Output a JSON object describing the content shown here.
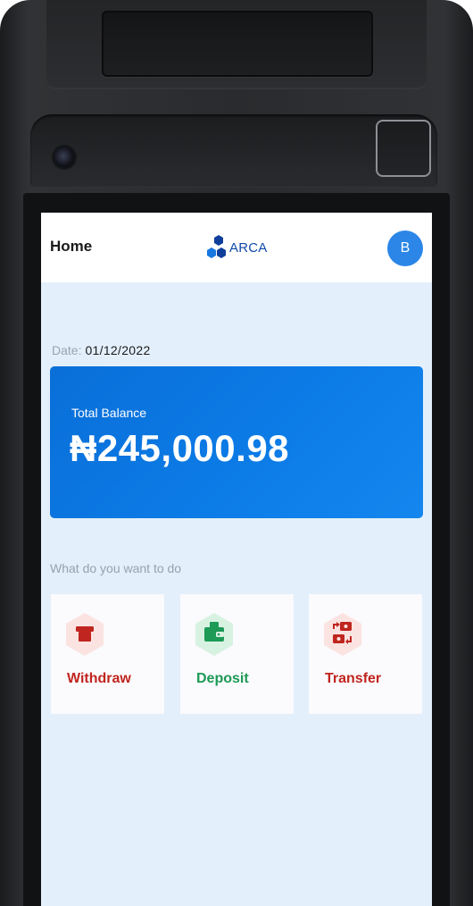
{
  "header": {
    "title": "Home",
    "logo_text": "ARCA",
    "avatar_initial": "B"
  },
  "date": {
    "label": "Date:",
    "value": "01/12/2022"
  },
  "balance": {
    "label": "Total Balance",
    "amount": "₦245,000.98"
  },
  "actions": {
    "prompt": "What do you want to do",
    "items": [
      {
        "label": "Withdraw",
        "icon": "atm-withdraw-icon",
        "color": "#c0251f",
        "bg": "#fbe3e1"
      },
      {
        "label": "Deposit",
        "icon": "wallet-icon",
        "color": "#1d9a56",
        "bg": "#d8f2e2"
      },
      {
        "label": "Transfer",
        "icon": "transfer-icon",
        "color": "#c0251f",
        "bg": "#fbe3e1"
      }
    ]
  },
  "colors": {
    "primary": "#0c7be6",
    "avatar": "#2b86e8",
    "screen_bg": "#e3effb",
    "logo": "#0f4aa8"
  }
}
